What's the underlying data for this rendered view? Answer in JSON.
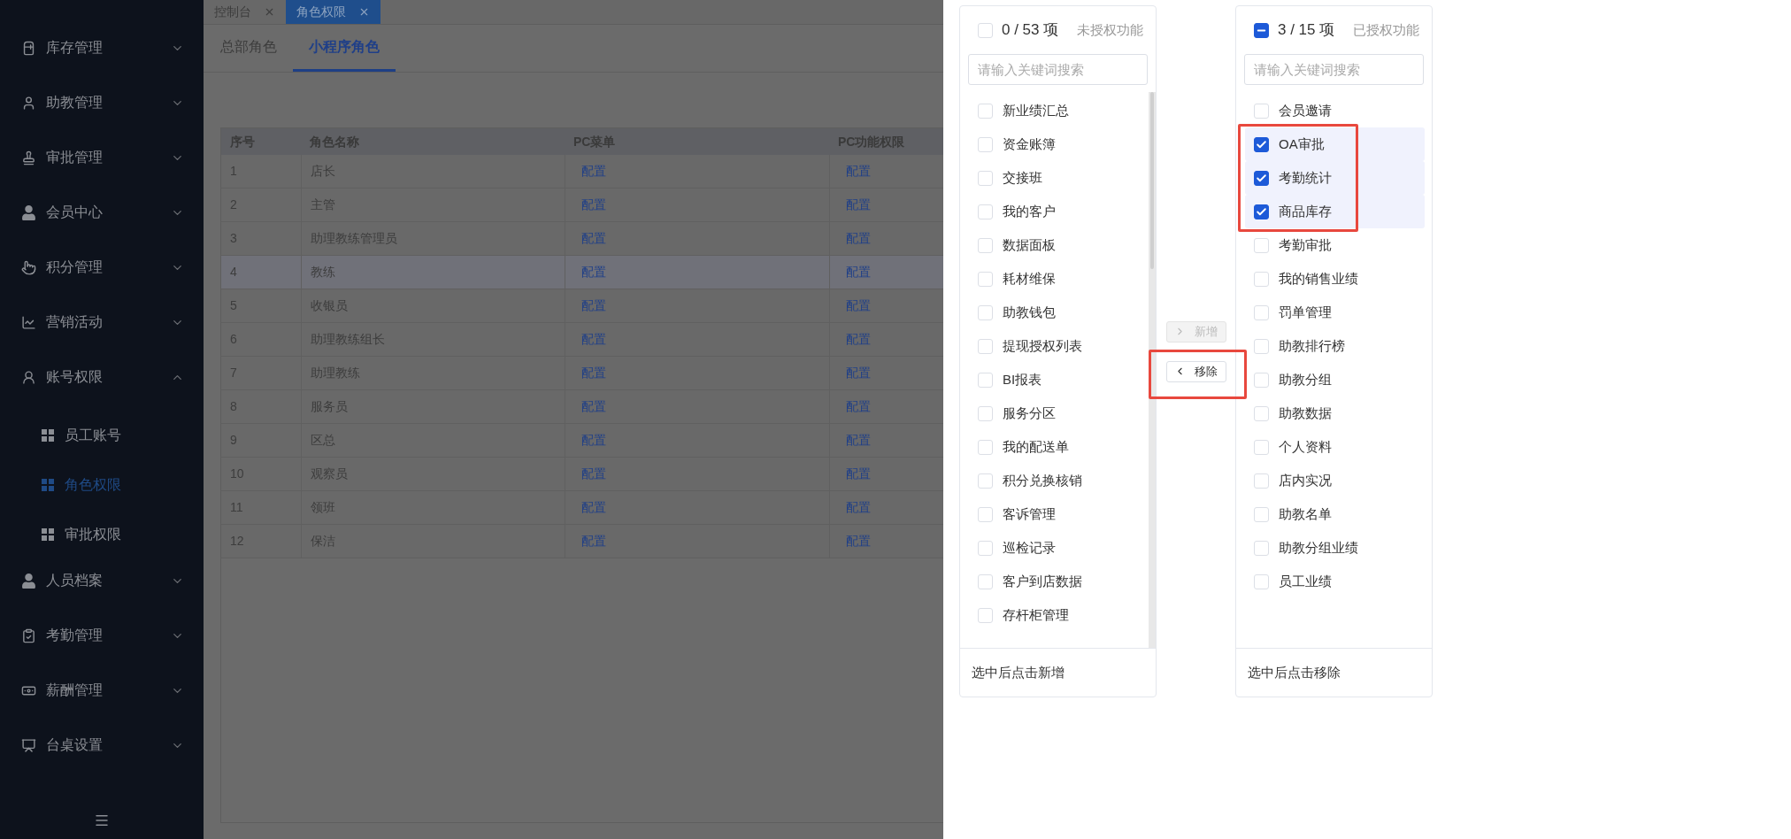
{
  "sidebar": {
    "items": [
      {
        "label": "库存管理",
        "expanded": false
      },
      {
        "label": "助教管理",
        "expanded": false
      },
      {
        "label": "审批管理",
        "expanded": false
      },
      {
        "label": "会员中心",
        "expanded": false
      },
      {
        "label": "积分管理",
        "expanded": false
      },
      {
        "label": "营销活动",
        "expanded": false
      },
      {
        "label": "账号权限",
        "expanded": true,
        "children": [
          {
            "label": "员工账号",
            "selected": false
          },
          {
            "label": "角色权限",
            "selected": true
          },
          {
            "label": "审批权限",
            "selected": false
          }
        ]
      },
      {
        "label": "人员档案",
        "expanded": false
      },
      {
        "label": "考勤管理",
        "expanded": false
      },
      {
        "label": "薪酬管理",
        "expanded": false
      },
      {
        "label": "台桌设置",
        "expanded": false
      }
    ]
  },
  "page_tabs": [
    {
      "label": "控制台",
      "selected": false
    },
    {
      "label": "角色权限",
      "selected": true
    }
  ],
  "sub_tabs": [
    {
      "label": "总部角色",
      "selected": false
    },
    {
      "label": "小程序角色",
      "selected": true
    }
  ],
  "table": {
    "columns": [
      "序号",
      "角色名称",
      "PC菜单",
      "PC功能权限"
    ],
    "rows": [
      {
        "cells": [
          "1",
          "店长",
          "配置",
          "配置"
        ],
        "selected": false
      },
      {
        "cells": [
          "2",
          "主管",
          "配置",
          "配置"
        ],
        "selected": false
      },
      {
        "cells": [
          "3",
          "助理教练管理员",
          "配置",
          "配置"
        ],
        "selected": false
      },
      {
        "cells": [
          "4",
          "教练",
          "配置",
          "配置"
        ],
        "selected": true
      },
      {
        "cells": [
          "5",
          "收银员",
          "配置",
          "配置"
        ],
        "selected": false
      },
      {
        "cells": [
          "6",
          "助理教练组长",
          "配置",
          "配置"
        ],
        "selected": false
      },
      {
        "cells": [
          "7",
          "助理教练",
          "配置",
          "配置"
        ],
        "selected": false
      },
      {
        "cells": [
          "8",
          "服务员",
          "配置",
          "配置"
        ],
        "selected": false
      },
      {
        "cells": [
          "9",
          "区总",
          "配置",
          "配置"
        ],
        "selected": false
      },
      {
        "cells": [
          "10",
          "观察员",
          "配置",
          "配置"
        ],
        "selected": false
      },
      {
        "cells": [
          "11",
          "领班",
          "配置",
          "配置"
        ],
        "selected": false
      },
      {
        "cells": [
          "12",
          "保洁",
          "配置",
          "配置"
        ],
        "selected": false
      }
    ]
  },
  "transfer": {
    "left": {
      "count": "0 / 53 项",
      "title": "未授权功能",
      "checked": false,
      "indeterminate": false,
      "placeholder": "请输入关键词搜索",
      "footer": "选中后点击新增",
      "items": [
        {
          "label": "新业绩汇总",
          "checked": false,
          "highlighted": false
        },
        {
          "label": "资金账簿",
          "checked": false,
          "highlighted": false
        },
        {
          "label": "交接班",
          "checked": false,
          "highlighted": false
        },
        {
          "label": "我的客户",
          "checked": false,
          "highlighted": false
        },
        {
          "label": "数据面板",
          "checked": false,
          "highlighted": false
        },
        {
          "label": "耗材维保",
          "checked": false,
          "highlighted": false
        },
        {
          "label": "助教钱包",
          "checked": false,
          "highlighted": false
        },
        {
          "label": "提现授权列表",
          "checked": false,
          "highlighted": false
        },
        {
          "label": "BI报表",
          "checked": false,
          "highlighted": false
        },
        {
          "label": "服务分区",
          "checked": false,
          "highlighted": false
        },
        {
          "label": "我的配送单",
          "checked": false,
          "highlighted": false
        },
        {
          "label": "积分兑换核销",
          "checked": false,
          "highlighted": false
        },
        {
          "label": "客诉管理",
          "checked": false,
          "highlighted": false
        },
        {
          "label": "巡检记录",
          "checked": false,
          "highlighted": false
        },
        {
          "label": "客户到店数据",
          "checked": false,
          "highlighted": false
        },
        {
          "label": "存杆柜管理",
          "checked": false,
          "highlighted": false
        }
      ]
    },
    "buttons": [
      {
        "label": "新增",
        "kind": "forward",
        "disabled": true,
        "highlighted": false
      },
      {
        "label": "移除",
        "kind": "back",
        "disabled": false,
        "highlighted": true
      }
    ],
    "right": {
      "count": "3 / 15 项",
      "title": "已授权功能",
      "checked": false,
      "indeterminate": true,
      "placeholder": "请输入关键词搜索",
      "footer": "选中后点击移除",
      "items": [
        {
          "label": "会员邀请",
          "checked": false,
          "highlighted": false
        },
        {
          "label": "OA审批",
          "checked": true,
          "highlighted": true
        },
        {
          "label": "考勤统计",
          "checked": true,
          "highlighted": true
        },
        {
          "label": "商品库存",
          "checked": true,
          "highlighted": true
        },
        {
          "label": "考勤审批",
          "checked": false,
          "highlighted": false
        },
        {
          "label": "我的销售业绩",
          "checked": false,
          "highlighted": false
        },
        {
          "label": "罚单管理",
          "checked": false,
          "highlighted": false
        },
        {
          "label": "助教排行榜",
          "checked": false,
          "highlighted": false
        },
        {
          "label": "助教分组",
          "checked": false,
          "highlighted": false
        },
        {
          "label": "助教数据",
          "checked": false,
          "highlighted": false
        },
        {
          "label": "个人资料",
          "checked": false,
          "highlighted": false
        },
        {
          "label": "店内实况",
          "checked": false,
          "highlighted": false
        },
        {
          "label": "助教名单",
          "checked": false,
          "highlighted": false
        },
        {
          "label": "助教分组业绩",
          "checked": false,
          "highlighted": false
        },
        {
          "label": "员工业绩",
          "checked": false,
          "highlighted": false
        }
      ]
    }
  }
}
